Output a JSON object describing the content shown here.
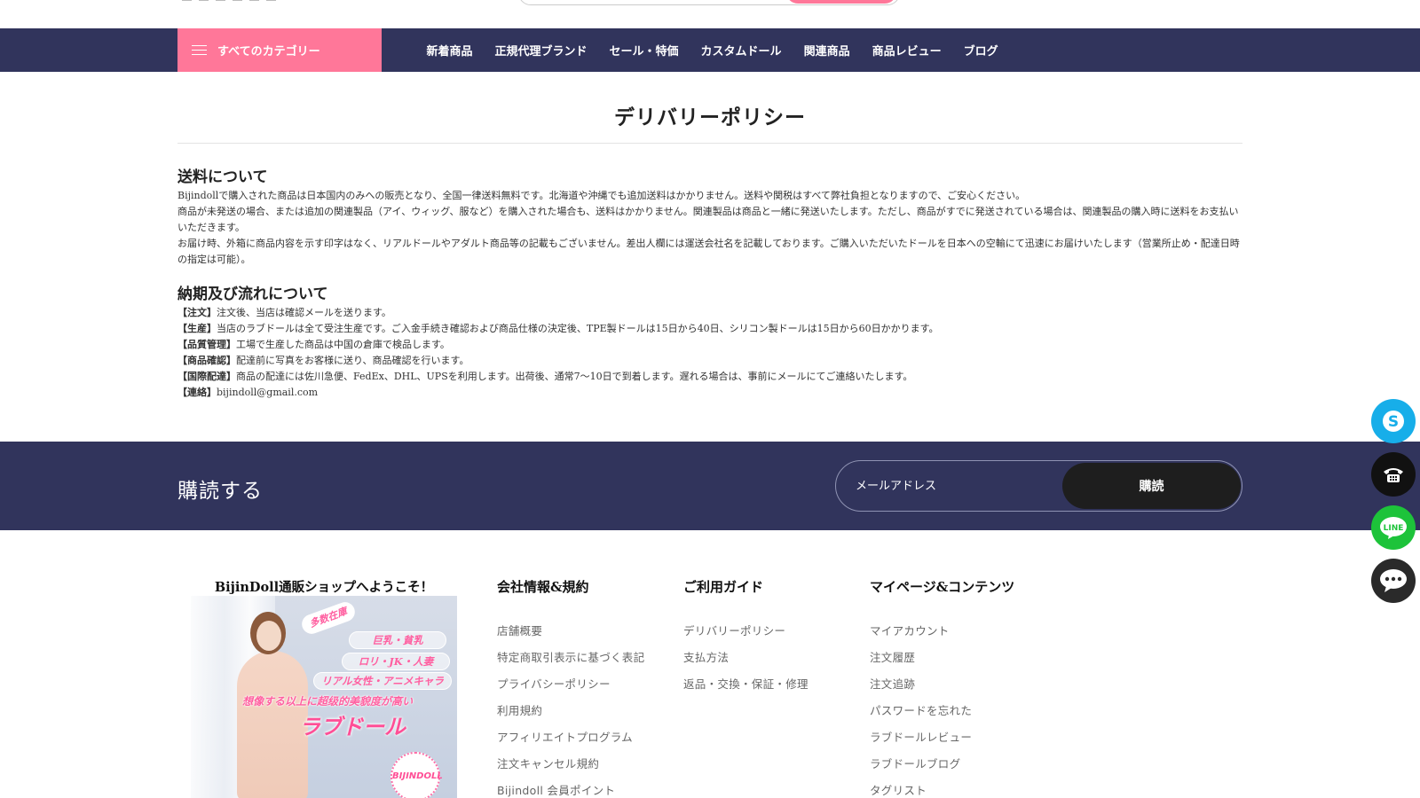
{
  "navbar": {
    "category_label": "すべてのカテゴリー",
    "links": [
      "新着商品",
      "正規代理ブランド",
      "セール・特価",
      "カスタムドール",
      "関連商品",
      "商品レビュー",
      "ブログ"
    ]
  },
  "content": {
    "title": "デリバリーポリシー",
    "shipping": {
      "heading": "送料について",
      "paragraphs": [
        "Bijindollで購入された商品は日本国内のみへの販売となり、全国一律送料無料です。北海道や沖縄でも追加送料はかかりません。送料や関税はすべて弊社負担となりますので、ご安心ください。",
        "商品が未発送の場合、または追加の関連製品（アイ、ウィッグ、服など）を購入された場合も、送料はかかりません。関連製品は商品と一緒に発送いたします。ただし、商品がすでに発送されている場合は、関連製品の購入時に送料をお支払いいただきます。",
        "お届け時、外箱に商品内容を示す印字はなく、リアルドールやアダルト商品等の記載もございません。差出人欄には運送会社名を記載しております。ご購入いただいたドールを日本への空輸にて迅速にお届けいたします（営業所止め・配達日時の指定は可能）。"
      ]
    },
    "flow": {
      "heading": "納期及び流れについて",
      "items": [
        {
          "label": "【注文】",
          "text": "注文後、当店は確認メールを送ります。"
        },
        {
          "label": "【生産】",
          "text": "当店のラブドールは全て受注生産です。ご入金手続き確認および商品仕様の決定後、TPE製ドールは15日から40日、シリコン製ドールは15日から60日かかります。"
        },
        {
          "label": "【品質管理】",
          "text": "工場で生産した商品は中国の倉庫で検品します。"
        },
        {
          "label": "【商品確認】",
          "text": "配達前に写真をお客様に送り、商品確認を行います。"
        },
        {
          "label": "【国際配達】",
          "text": "商品の配達には佐川急便、FedEx、DHL、UPSを利用します。出荷後、通常7〜10日で到着します。遅れる場合は、事前にメールにてご連絡いたします。"
        },
        {
          "label": "【連絡】",
          "text": "bijindoll@gmail.com"
        }
      ]
    }
  },
  "subscribe": {
    "title": "購読する",
    "placeholder": "メールアドレス",
    "button": "購読"
  },
  "footer": {
    "welcome": "BijinDoll通販ショップへようこそ！",
    "banner": {
      "badge": "多数在庫",
      "tags": [
        "巨乳・貧乳",
        "ロリ・JK・人妻",
        "リアル女性・アニメキャラ"
      ],
      "headline": "想像する以上に超级的美貌度が高い",
      "big": "ラブドール",
      "logo": "BIJINDOLL"
    },
    "columns": [
      {
        "heading": "会社情報&規約",
        "links": [
          "店舗概要",
          "特定商取引表示に基づく表記",
          "プライバシーポリシー",
          "利用規約",
          "アフィリエイトプログラム",
          "注文キャンセル規約",
          "Bijindoll 会員ポイント"
        ]
      },
      {
        "heading": "ご利用ガイド",
        "links": [
          "デリバリーポリシー",
          "支払方法",
          "返品・交換・保証・修理"
        ]
      },
      {
        "heading": "マイページ&コンテンツ",
        "links": [
          "マイアカウント",
          "注文履歴",
          "注文追跡",
          "パスワードを忘れた",
          "ラブドールレビュー",
          "ラブドールブログ",
          "タグリスト"
        ]
      }
    ]
  },
  "colors": {
    "nav_bg": "#31345c",
    "accent_pink": "#ff7799",
    "skype": "#17aee9",
    "line": "#1dc33a"
  },
  "float_icons": [
    "skype-icon",
    "phone-icon",
    "line-icon",
    "chat-icon"
  ]
}
